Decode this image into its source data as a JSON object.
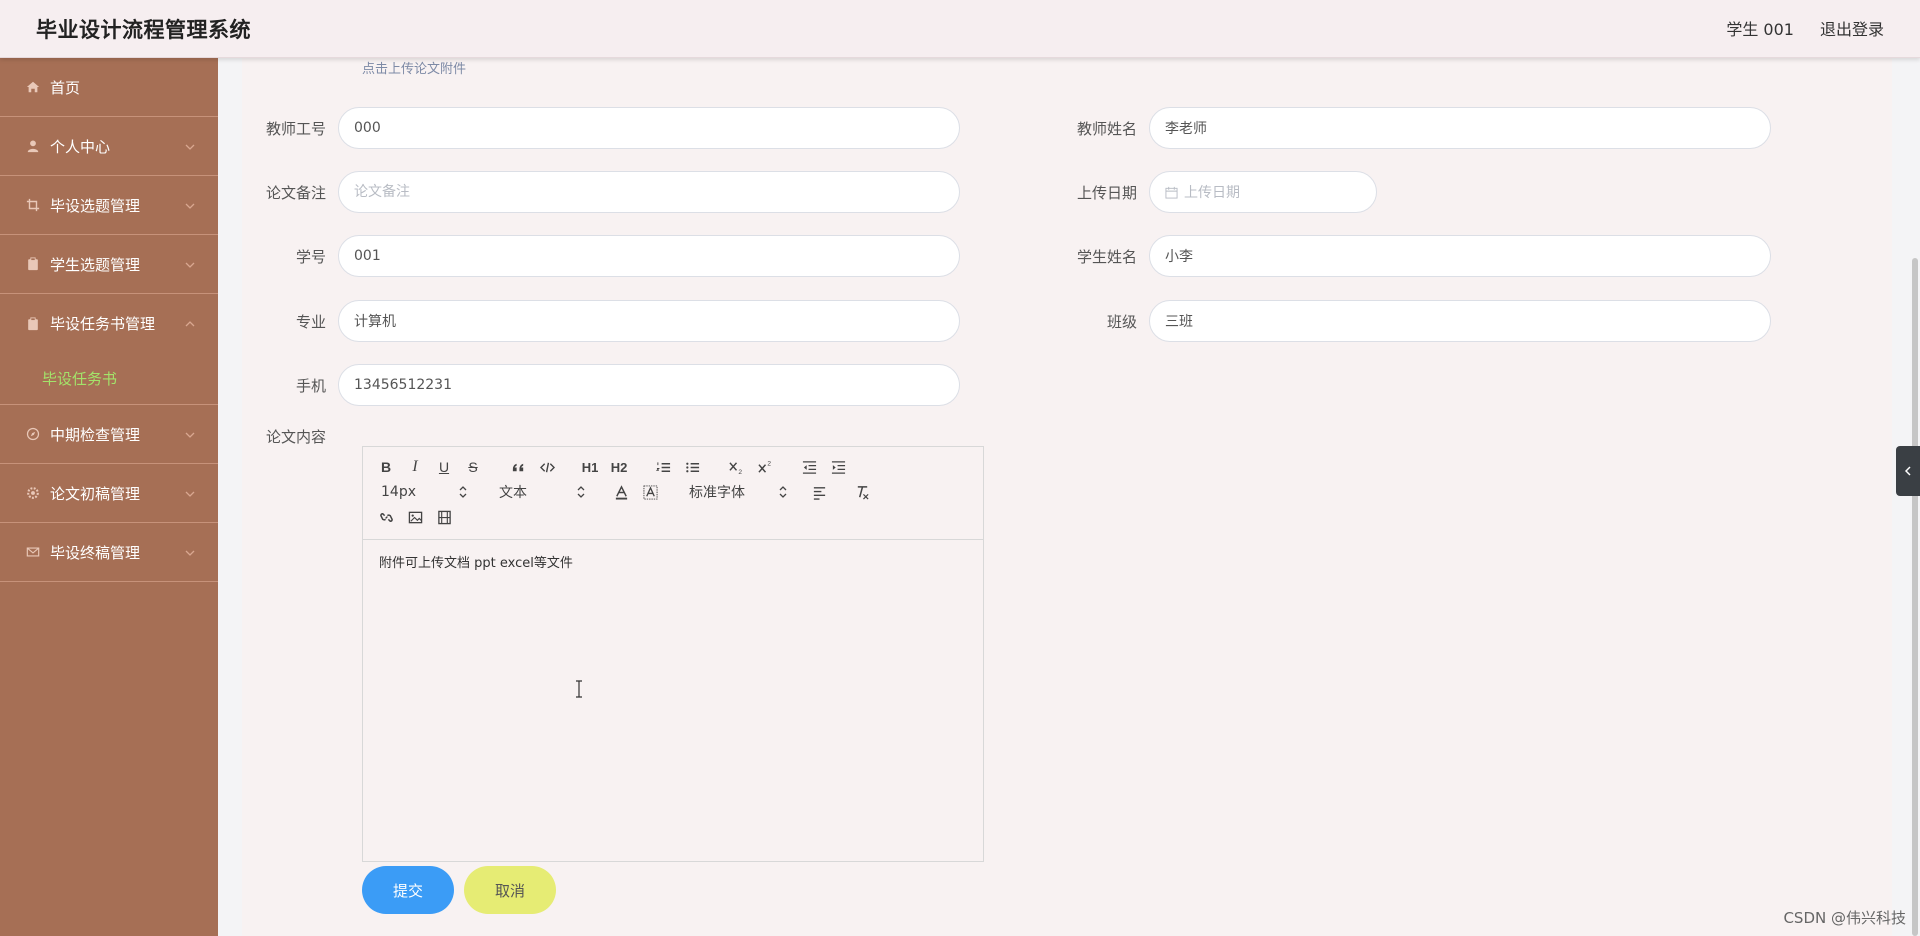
{
  "header": {
    "title": "毕业设计流程管理系统",
    "user": "学生 001",
    "logout": "退出登录"
  },
  "sidebar": {
    "items": [
      {
        "label": "首页",
        "icon": "home-icon"
      },
      {
        "label": "个人中心",
        "icon": "user-icon"
      },
      {
        "label": "毕设选题管理",
        "icon": "crop-icon"
      },
      {
        "label": "学生选题管理",
        "icon": "clipboard-icon"
      },
      {
        "label": "毕设任务书管理",
        "icon": "clipboard-icon",
        "expanded": true,
        "sub": "毕设任务书"
      },
      {
        "label": "中期检查管理",
        "icon": "compass-icon"
      },
      {
        "label": "论文初稿管理",
        "icon": "gear-icon"
      },
      {
        "label": "毕设终稿管理",
        "icon": "mail-icon"
      }
    ]
  },
  "form": {
    "upload_hint": "点击上传论文附件",
    "teacher_id": {
      "label": "教师工号",
      "value": "000"
    },
    "teacher_name": {
      "label": "教师姓名",
      "value": "李老师"
    },
    "note": {
      "label": "论文备注",
      "placeholder": "论文备注"
    },
    "upload_date": {
      "label": "上传日期",
      "placeholder": "上传日期"
    },
    "student_id": {
      "label": "学号",
      "value": "001"
    },
    "student_name": {
      "label": "学生姓名",
      "value": "小李"
    },
    "major": {
      "label": "专业",
      "value": "计算机"
    },
    "class": {
      "label": "班级",
      "value": "三班"
    },
    "phone": {
      "label": "手机",
      "value": "13456512231"
    },
    "content": {
      "label": "论文内容",
      "text": "附件可上传文档 ppt  excel等文件"
    }
  },
  "editor": {
    "size_picker": "14px",
    "header_picker": "文本",
    "font_picker": "标准字体",
    "h1": "H1",
    "h2": "H2"
  },
  "buttons": {
    "submit": "提交",
    "cancel": "取消"
  },
  "watermark": "CSDN @伟兴科技",
  "colors": {
    "sidebar_bg": "#a66f55",
    "active_submenu": "#a3e36a",
    "submit": "#3b9cf6",
    "cancel": "#e6ec74"
  }
}
